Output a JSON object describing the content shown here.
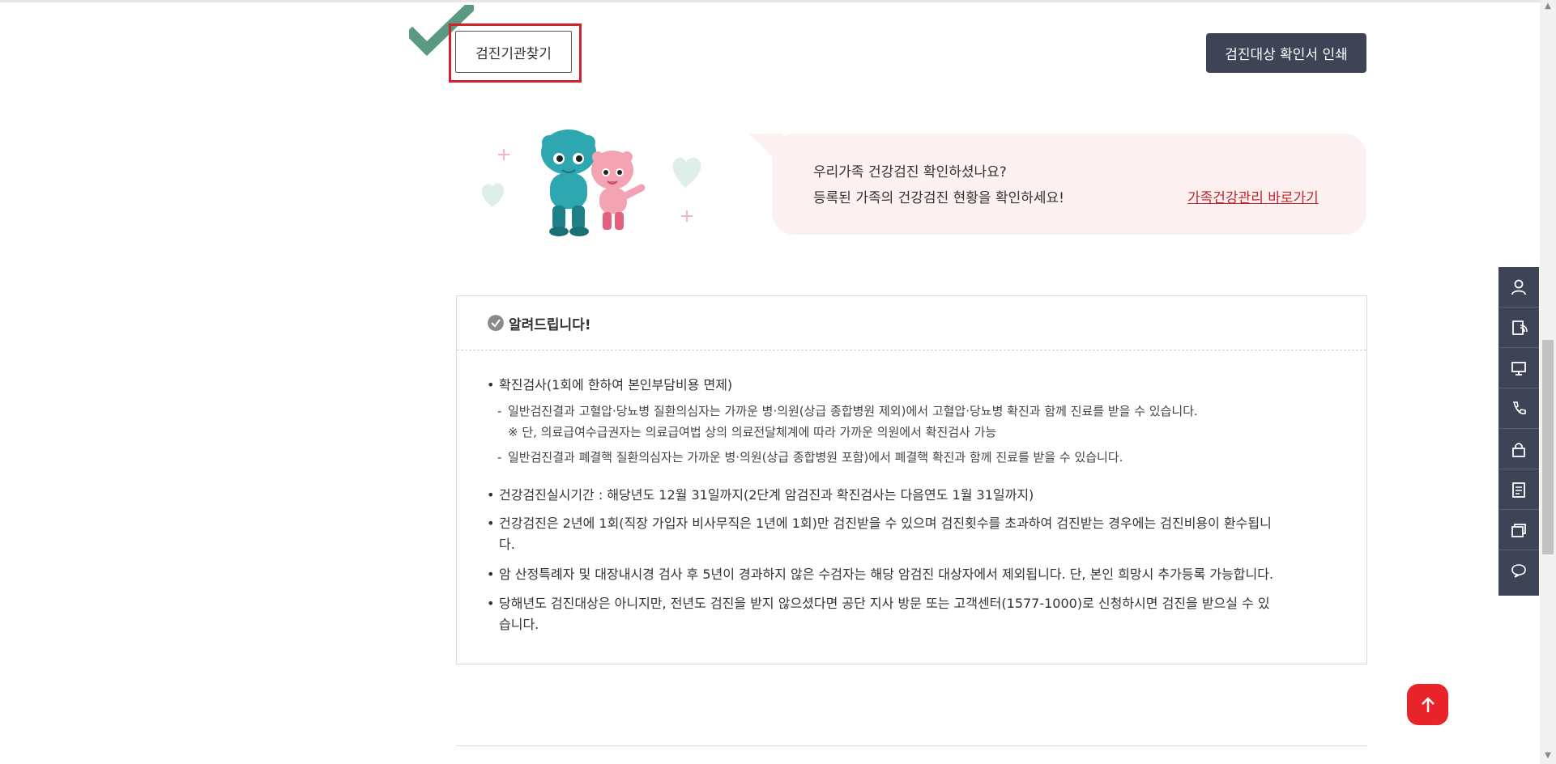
{
  "buttons": {
    "find_institution": "검진기관찾기",
    "print_confirmation": "검진대상 확인서 인쇄"
  },
  "family_banner": {
    "line1": "우리가족 건강검진 확인하셨나요?",
    "line2": "등록된 가족의 건강검진 현황을 확인하세요!",
    "link": "가족건강관리 바로가기"
  },
  "notice": {
    "title": "알려드립니다!",
    "items": [
      "확진검사(1회에 한하여 본인부담비용 면제)",
      "건강검진실시기간 : 해당년도 12월 31일까지(2단계 암검진과 확진검사는 다음연도 1월 31일까지)",
      "건강검진은 2년에 1회(직장 가입자 비사무직은 1년에 1회)만 검진받을 수 있으며 검진횟수를 초과하여 검진받는 경우에는 검진비용이 환수됩니",
      "다.",
      "암 산정특례자 및 대장내시경 검사 후 5년이 경과하지 않은 수검자는 해당 암검진 대상자에서 제외됩니다. 단, 본인 희망시 추가등록 가능합니다.",
      "당해년도 검진대상은 아니지만, 전년도 검진을 받지 않으셨다면 공단 지사 방문 또는 고객센터(1577-1000)로 신청하시면 검진을 받으실 수 있",
      "습니다."
    ],
    "sub_items": [
      "일반검진결과 고혈압·당뇨병 질환의심자는 가까운 병·의원(상급 종합병원 제외)에서 고혈압·당뇨병 확진과 함께 진료를 받을 수 있습니다.",
      "※ 단, 의료급여수급권자는 의료급여법 상의 의료전달체계에 따라 가까운 의원에서 확진검사 가능",
      "일반검진결과 폐결핵 질환의심자는 가까운 병·의원(상급 종합병원 포함)에서 폐결핵 확진과 함께 진료를 받을 수 있습니다."
    ],
    "bullet_char": "•",
    "dash_char": "-"
  },
  "quick_menu": [
    "user-icon",
    "document-send-icon",
    "monitor-icon",
    "phone-icon",
    "lock-icon",
    "notepad-icon",
    "windows-icon",
    "chat-icon"
  ],
  "colors": {
    "accent_red": "#e8242a",
    "dark_navy": "#3e4456",
    "banner_pink": "#fdf0f1",
    "link_red": "#c0252b",
    "highlight_red": "#d2232a",
    "check_green": "#5a9a80"
  }
}
